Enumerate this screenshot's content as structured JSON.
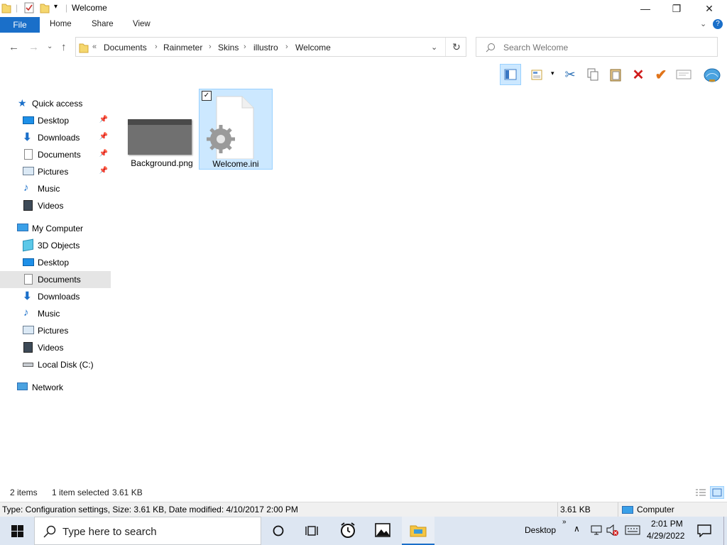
{
  "window": {
    "title": "Welcome",
    "minimize_glyph": "—",
    "maximize_glyph": "❐",
    "close_glyph": "✕"
  },
  "ribbon": {
    "tabs": [
      {
        "label": "File"
      },
      {
        "label": "Home"
      },
      {
        "label": "Share"
      },
      {
        "label": "View"
      }
    ]
  },
  "address": {
    "prefix": "«",
    "crumbs": [
      "Documents",
      "Rainmeter",
      "Skins",
      "illustro",
      "Welcome"
    ],
    "separator": "›"
  },
  "search": {
    "placeholder": "Search Welcome"
  },
  "nav": {
    "quick_access": {
      "label": "Quick access",
      "items": [
        {
          "label": "Desktop",
          "icon": "desktop-icon",
          "pinned": true
        },
        {
          "label": "Downloads",
          "icon": "download-icon",
          "pinned": true
        },
        {
          "label": "Documents",
          "icon": "document-icon",
          "pinned": true
        },
        {
          "label": "Pictures",
          "icon": "pictures-icon",
          "pinned": true
        },
        {
          "label": "Music",
          "icon": "music-icon",
          "pinned": false
        },
        {
          "label": "Videos",
          "icon": "videos-icon",
          "pinned": false
        }
      ]
    },
    "computer": {
      "label": "My Computer",
      "items": [
        {
          "label": "3D Objects",
          "icon": "3d-objects-icon"
        },
        {
          "label": "Desktop",
          "icon": "desktop-icon"
        },
        {
          "label": "Documents",
          "icon": "document-icon",
          "selected": true
        },
        {
          "label": "Downloads",
          "icon": "download-icon"
        },
        {
          "label": "Music",
          "icon": "music-icon"
        },
        {
          "label": "Pictures",
          "icon": "pictures-icon"
        },
        {
          "label": "Videos",
          "icon": "videos-icon"
        },
        {
          "label": "Local Disk (C:)",
          "icon": "disk-icon"
        }
      ]
    },
    "network": {
      "label": "Network"
    }
  },
  "files": [
    {
      "name": "Background.png",
      "type": "image",
      "selected": false
    },
    {
      "name": "Welcome.ini",
      "type": "config",
      "selected": true
    }
  ],
  "status": {
    "item_count": "2 items",
    "selection": "1 item selected",
    "size": "3.61 KB"
  },
  "details": {
    "info": "Type: Configuration settings, Size: 3.61 KB, Date modified: 4/10/2017 2:00 PM",
    "size": "3.61 KB",
    "location": "Computer"
  },
  "taskbar": {
    "search_placeholder": "Type here to search",
    "desktop_label": "Desktop",
    "time": "2:01 PM",
    "date": "4/29/2022"
  },
  "colors": {
    "accent": "#1a6fc9",
    "selection": "#cce8ff",
    "selection_border": "#99d1ff",
    "nav_selected": "#e5e5e5",
    "taskbar": "#dde6f2"
  }
}
